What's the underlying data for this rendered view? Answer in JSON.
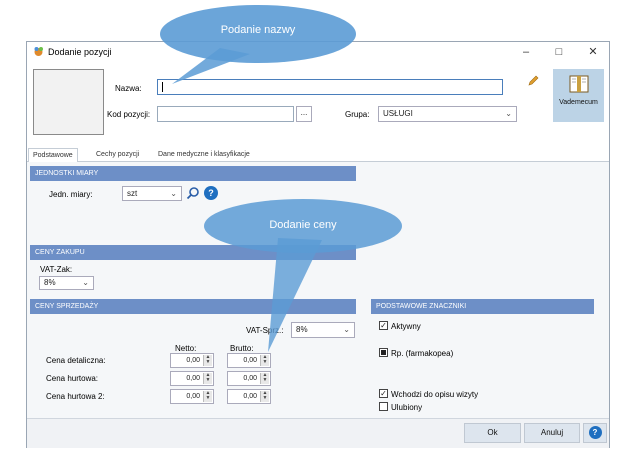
{
  "window": {
    "title": "Dodanie pozycji",
    "min": "–",
    "max": "□",
    "close": "✕"
  },
  "header": {
    "name_label": "Nazwa:",
    "name_value": "",
    "code_label": "Kod pozycji:",
    "code_value": "",
    "code_button": "...",
    "group_label": "Grupa:",
    "group_value": "USŁUGI",
    "vademecum_label": "Vademecum"
  },
  "tabs": [
    {
      "label": "Podstawowe"
    },
    {
      "label": "Cechy pozycji"
    },
    {
      "label": "Dane medyczne i klasyfikacje"
    }
  ],
  "units": {
    "header": "JEDNOSTKI MIARY",
    "unit_label": "Jedn. miary:",
    "unit_value": "szt"
  },
  "purchase": {
    "header": "CENY ZAKUPU",
    "vat_label": "VAT-Zak:",
    "vat_value": "8%"
  },
  "sales": {
    "header": "CENY SPRZEDAŻY",
    "vat_label": "VAT-Sprz.:",
    "vat_value": "8%",
    "netto_header": "Netto:",
    "brutto_header": "Brutto:",
    "rows": [
      {
        "label": "Cena detaliczna:",
        "netto": "0,00",
        "brutto": "0,00"
      },
      {
        "label": "Cena hurtowa:",
        "netto": "0,00",
        "brutto": "0,00"
      },
      {
        "label": "Cena hurtowa 2:",
        "netto": "0,00",
        "brutto": "0,00"
      }
    ]
  },
  "flags": {
    "header": "PODSTAWOWE ZNACZNIKI",
    "items": [
      {
        "label": "Aktywny",
        "checked": true
      },
      {
        "label": "Rp. (farmakopea)",
        "checked": true
      },
      {
        "label": "Wchodzi do opisu wizyty",
        "checked": true
      },
      {
        "label": "Ulubiony",
        "checked": false
      }
    ]
  },
  "footer": {
    "ok": "Ok",
    "cancel": "Anuluj",
    "help": "?"
  },
  "callouts": {
    "name": "Podanie nazwy",
    "price": "Dodanie ceny"
  },
  "colors": {
    "accent": "#6d8fc7",
    "callout": "#5b9bd5",
    "help": "#1f6fc0"
  }
}
